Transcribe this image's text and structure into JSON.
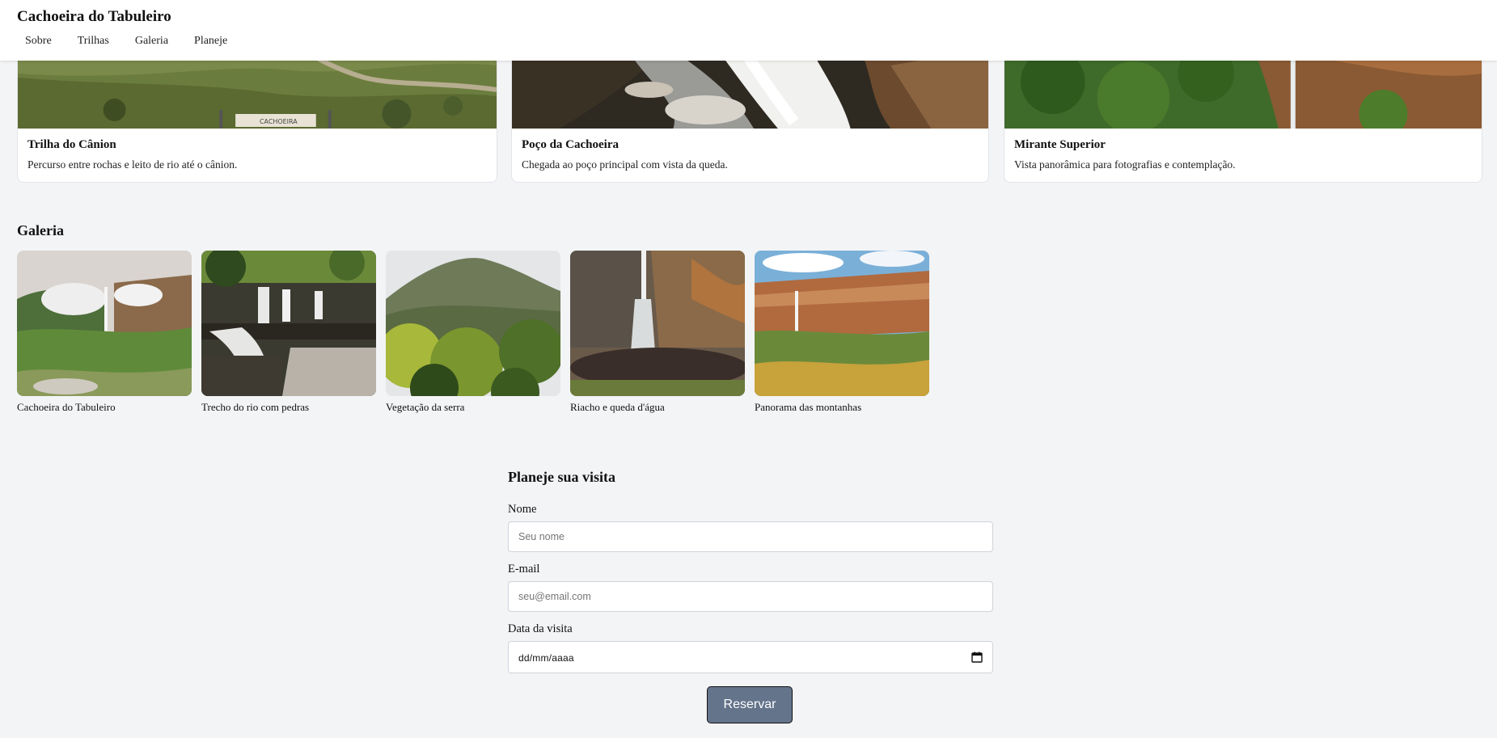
{
  "header": {
    "title": "Cachoeira do Tabuleiro",
    "nav": [
      "Sobre",
      "Trilhas",
      "Galeria",
      "Planeje"
    ]
  },
  "trails": [
    {
      "title": "Trilha do Cânion",
      "desc": "Percurso entre rochas e leito de rio até o cânion.",
      "sign_text": "CACHOEIRA"
    },
    {
      "title": "Poço da Cachoeira",
      "desc": "Chegada ao poço principal com vista da queda."
    },
    {
      "title": "Mirante Superior",
      "desc": "Vista panorâmica para fotografias e contemplação."
    }
  ],
  "gallery": {
    "heading": "Galeria",
    "items": [
      {
        "caption": "Cachoeira do Tabuleiro"
      },
      {
        "caption": "Trecho do rio com pedras"
      },
      {
        "caption": "Vegetação da serra"
      },
      {
        "caption": "Riacho e queda d'água"
      },
      {
        "caption": "Panorama das montanhas"
      }
    ]
  },
  "form": {
    "heading": "Planeje sua visita",
    "name_label": "Nome",
    "name_placeholder": "Seu nome",
    "email_label": "E-mail",
    "email_placeholder": "seu@email.com",
    "date_label": "Data da visita",
    "date_placeholder": "dd/mm/aaaa",
    "submit_label": "Reservar"
  },
  "colors": {
    "background": "#f3f4f6",
    "button": "#64748b",
    "card": "#ffffff"
  }
}
